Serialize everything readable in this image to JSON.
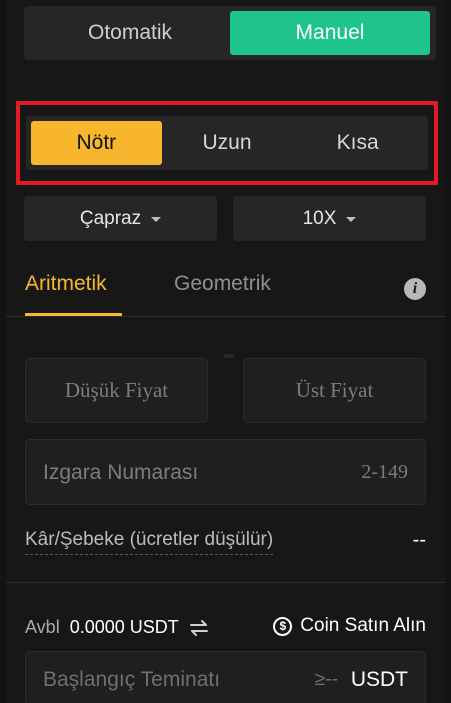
{
  "mode_toggle": {
    "options": [
      "Otomatik",
      "Manuel"
    ],
    "selected": "Manuel"
  },
  "direction_toggle": {
    "options": [
      "Nötr",
      "Uzun",
      "Kısa"
    ],
    "selected": "Nötr"
  },
  "margin_mode": {
    "label": "Çapraz"
  },
  "leverage": {
    "label": "10X"
  },
  "grid_tabs": {
    "items": [
      "Aritmetik",
      "Geometrik"
    ],
    "selected": "Aritmetik"
  },
  "info_icon_glyph": "i",
  "price_inputs": {
    "lower_placeholder": "Düşük Fiyat",
    "upper_placeholder": "Üst Fiyat"
  },
  "grid_count": {
    "placeholder": "Izgara Numarası",
    "range": "2-149"
  },
  "profit_per_grid": {
    "label": "Kâr/Şebeke (ücretler düşülür)",
    "value": "--"
  },
  "available": {
    "label": "Avbl",
    "value": "0.0000 USDT"
  },
  "buy_coin": {
    "label": "Coin Satın Alın",
    "icon": "$"
  },
  "initial_margin": {
    "placeholder": "Başlangıç Teminatı",
    "min": "≥--",
    "unit": "USDT"
  },
  "colors": {
    "accent_green": "#1fc48a",
    "accent_yellow": "#f7b62d",
    "highlight_red": "#e11b24",
    "background": "#171717"
  }
}
